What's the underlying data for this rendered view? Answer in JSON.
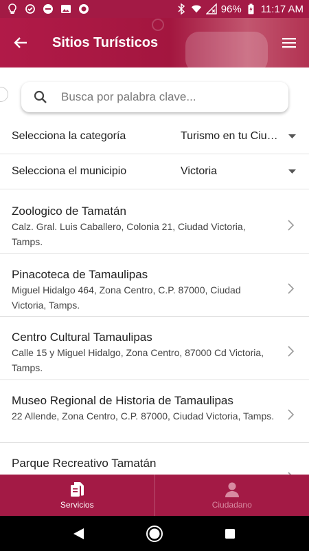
{
  "status_bar": {
    "battery": "96%",
    "time": "11:17 AM"
  },
  "app_bar": {
    "title": "Sitios Turísticos"
  },
  "search": {
    "placeholder": "Busca por palabra clave..."
  },
  "filters": {
    "category": {
      "label": "Selecciona la categoría",
      "value": "Turismo en tu Ciudad"
    },
    "municipality": {
      "label": "Selecciona el municipio",
      "value": "Victoria"
    }
  },
  "places": [
    {
      "name": "Zoologico de Tamatán",
      "address": "Calz. Gral. Luis Caballero, Colonia 21, Ciudad Victoria, Tamps."
    },
    {
      "name": "Pinacoteca de Tamaulipas",
      "address": "Miguel Hidalgo 464, Zona Centro, C.P. 87000, Ciudad Victoria, Tamps."
    },
    {
      "name": "Centro Cultural Tamaulipas",
      "address": "Calle 15 y Miguel Hidalgo, Zona Centro, 87000 Cd Victoria, Tamps."
    },
    {
      "name": "Museo Regional de Historia de Tamaulipas",
      "address": "22 Allende, Zona Centro, C.P. 87000, Ciudad Victoria, Tamps."
    },
    {
      "name": "Parque Recreativo Tamatán",
      "address": ""
    }
  ],
  "bottom_nav": {
    "items": [
      {
        "label": "Servicios",
        "icon": "documents-icon",
        "active": true
      },
      {
        "label": "Ciudadano",
        "icon": "person-icon",
        "active": false
      }
    ]
  },
  "colors": {
    "brand": "#a31a45",
    "inactive_nav": "#d88aa1"
  }
}
